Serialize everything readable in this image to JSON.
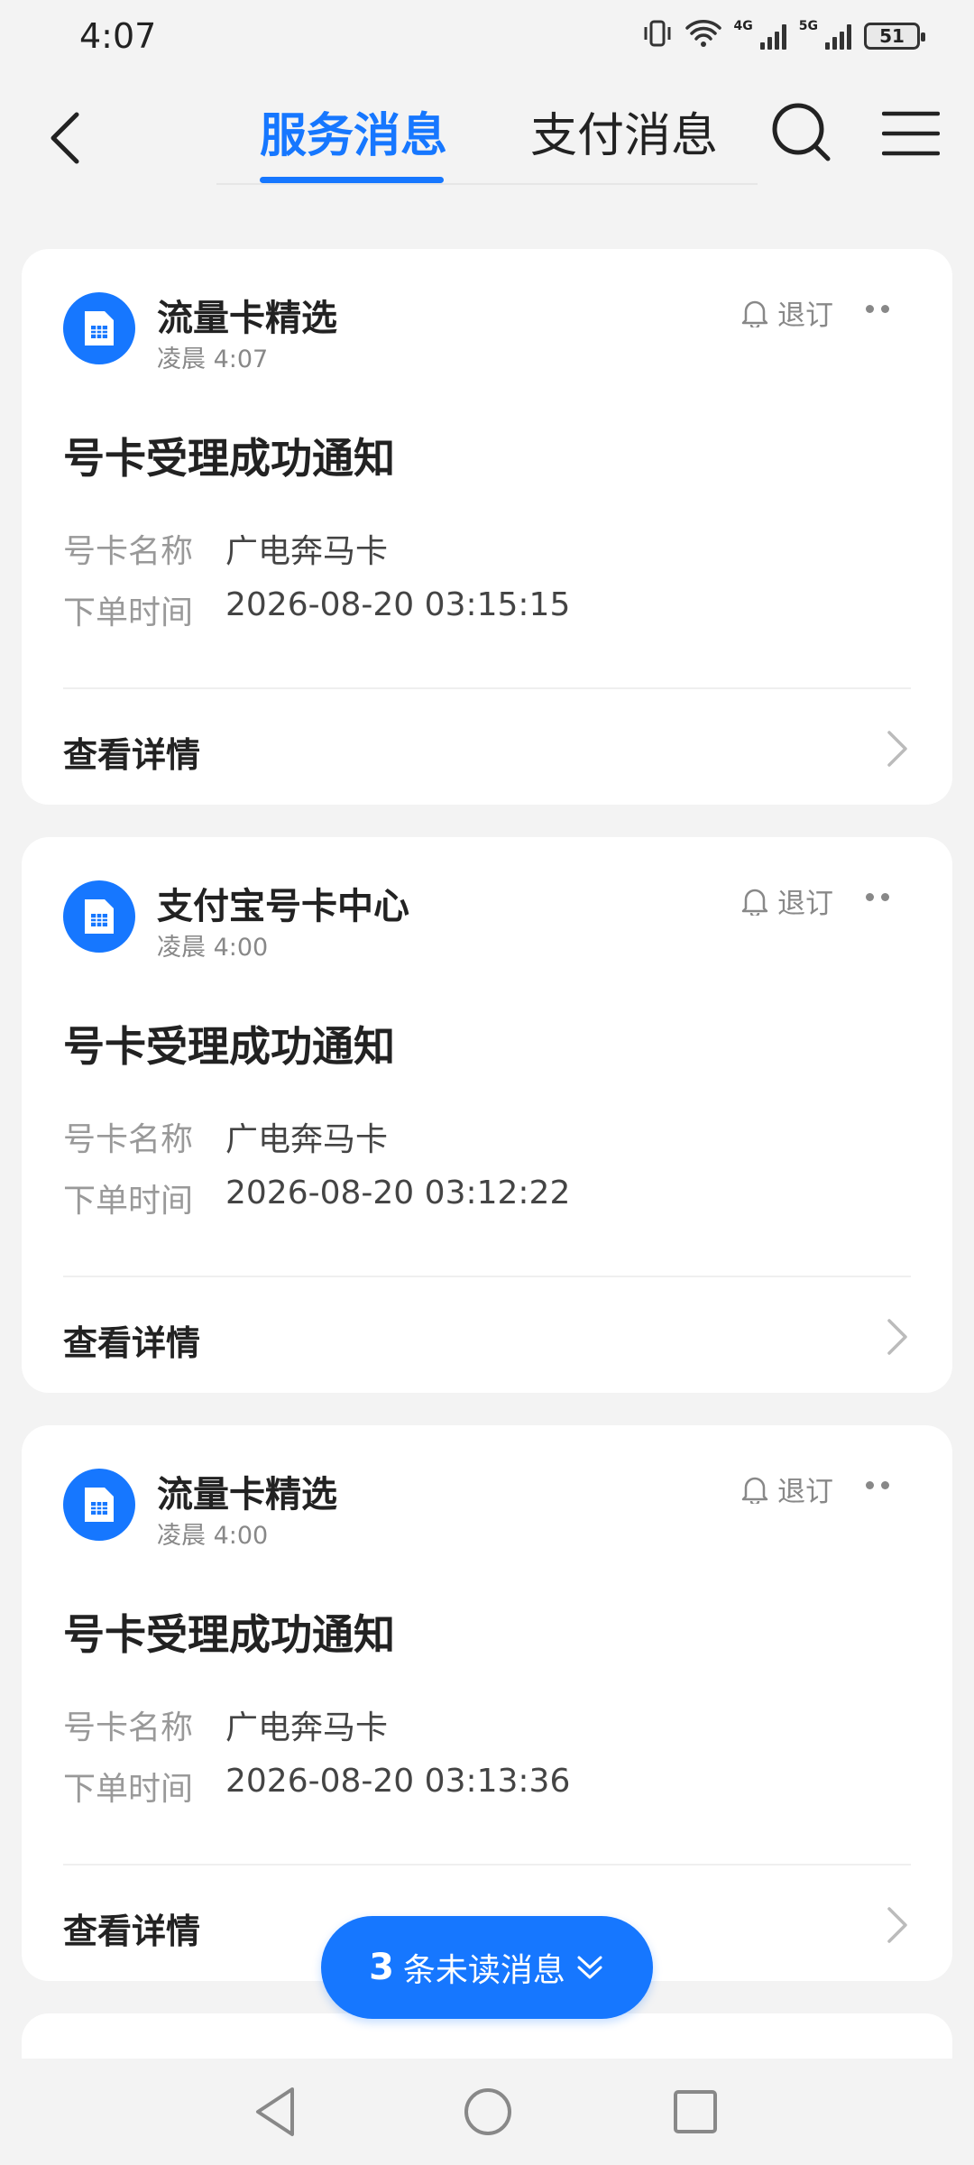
{
  "status_bar": {
    "time": "4:07",
    "net1": "4G",
    "net2": "5G",
    "battery": "51"
  },
  "header": {
    "tabs": [
      {
        "label": "服务消息",
        "active": true
      },
      {
        "label": "支付消息",
        "active": false
      }
    ]
  },
  "cards": [
    {
      "source": "流量卡精选",
      "time": "凌晨 4:07",
      "unsubscribe": "退订",
      "title": "号卡受理成功通知",
      "field1_label": "号卡名称",
      "field1_value": "广电奔马卡",
      "field2_label": "下单时间",
      "field2_value": "2026-08-20 03:15:15",
      "detail": "查看详情"
    },
    {
      "source": "支付宝号卡中心",
      "time": "凌晨 4:00",
      "unsubscribe": "退订",
      "title": "号卡受理成功通知",
      "field1_label": "号卡名称",
      "field1_value": "广电奔马卡",
      "field2_label": "下单时间",
      "field2_value": "2026-08-20 03:12:22",
      "detail": "查看详情"
    },
    {
      "source": "流量卡精选",
      "time": "凌晨 4:00",
      "unsubscribe": "退订",
      "title": "号卡受理成功通知",
      "field1_label": "号卡名称",
      "field1_value": "广电奔马卡",
      "field2_label": "下单时间",
      "field2_value": "2026-08-20 03:13:36",
      "detail": "查看详情"
    }
  ],
  "unread": {
    "count": "3",
    "label": "条未读消息"
  },
  "colors": {
    "accent": "#1677ff",
    "background": "#f3f3f3",
    "card": "#ffffff"
  }
}
